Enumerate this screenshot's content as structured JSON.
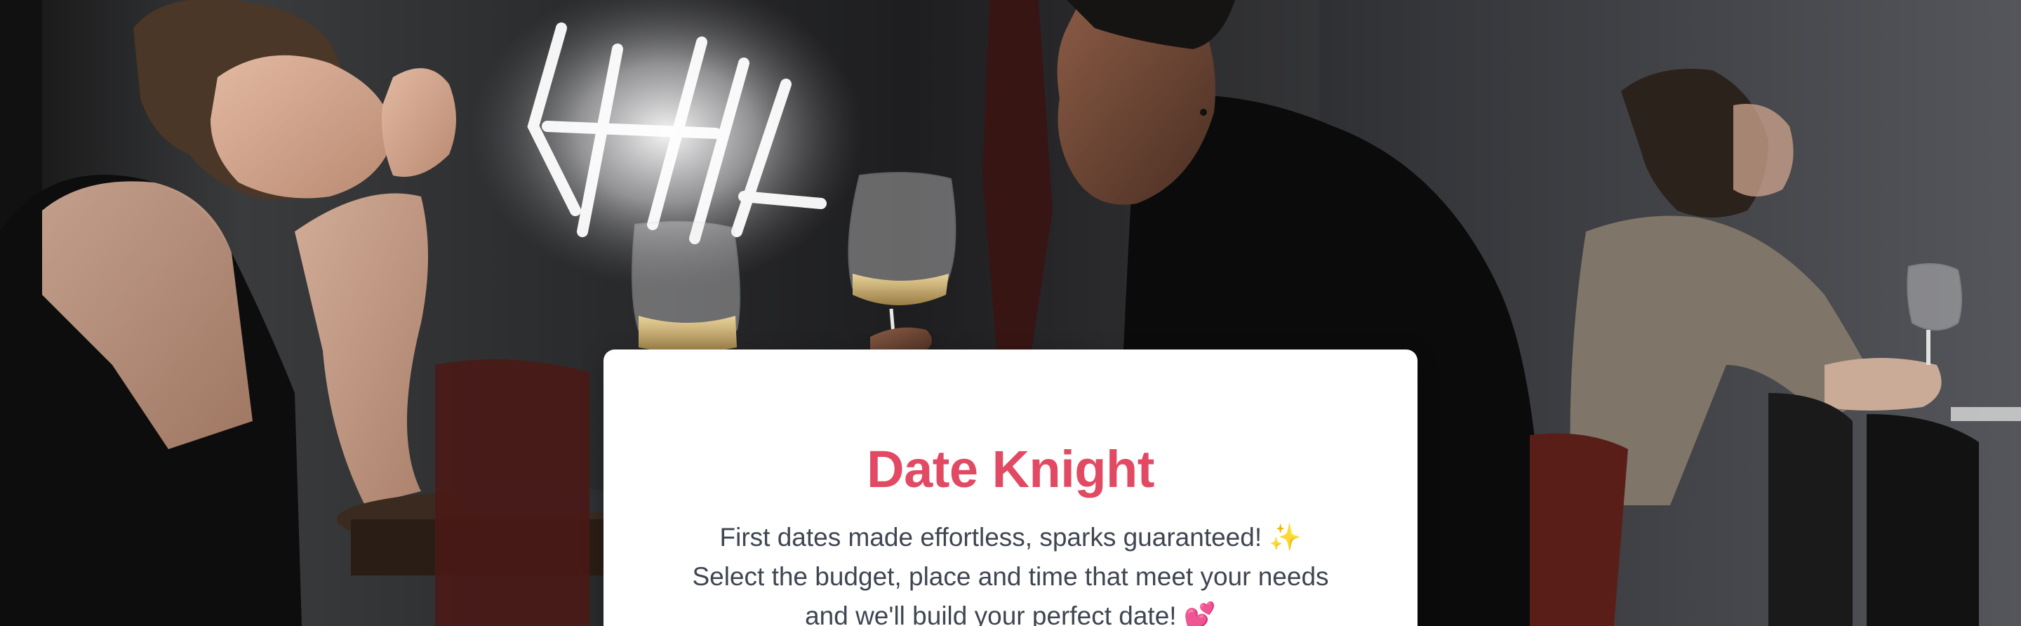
{
  "app": {
    "title": "Date Knight"
  },
  "hero": {
    "image": "couple-on-date-wine-bar-photo"
  },
  "card": {
    "title": "Date Knight",
    "tagline_lines": [
      "First dates made effortless, sparks guaranteed! ✨",
      "Select the budget, place and time that meet your needs",
      "and we'll build your perfect date! 💕"
    ]
  },
  "colors": {
    "brand": "#e24a63",
    "text": "#3f4651",
    "card_bg": "#ffffff"
  }
}
